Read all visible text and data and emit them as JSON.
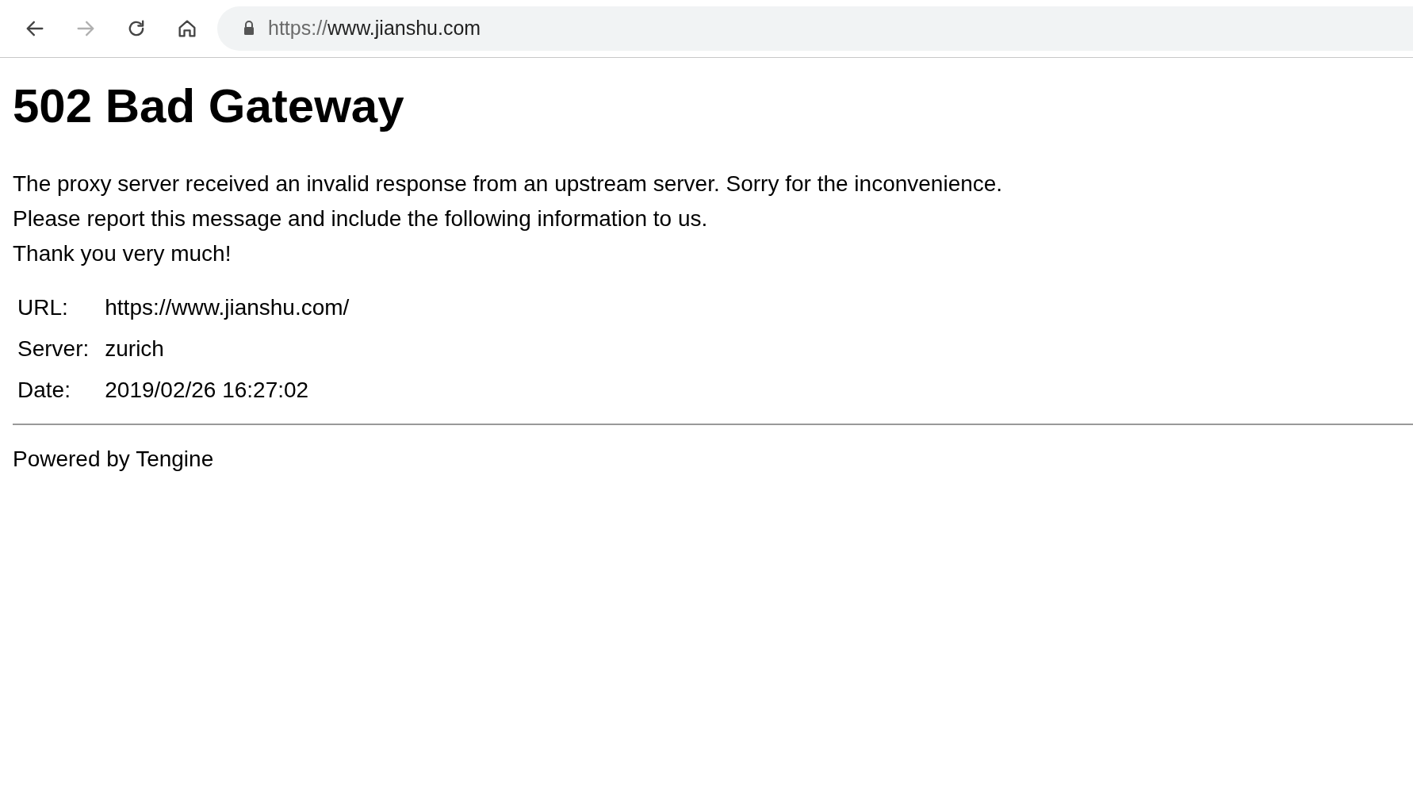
{
  "toolbar": {
    "nav_buttons": [
      {
        "kind": "back",
        "disabled": false
      },
      {
        "kind": "forward",
        "disabled": true
      },
      {
        "kind": "reload",
        "disabled": false
      },
      {
        "kind": "home",
        "disabled": false
      }
    ],
    "address_bar": {
      "scheme": "https://",
      "host": "www.jianshu.com"
    }
  },
  "page": {
    "heading": "502 Bad Gateway",
    "paragraph_lines": [
      "The proxy server received an invalid response from an upstream server. Sorry for the inconvenience.",
      "Please report this message and include the following information to us.",
      "Thank you very much!"
    ],
    "info_table": [
      {
        "label": "URL:",
        "value": "https://www.jianshu.com/"
      },
      {
        "label": "Server:",
        "value": "zurich"
      },
      {
        "label": "Date:",
        "value": "2019/02/26 16:27:02"
      }
    ],
    "footer": "Powered by Tengine"
  }
}
